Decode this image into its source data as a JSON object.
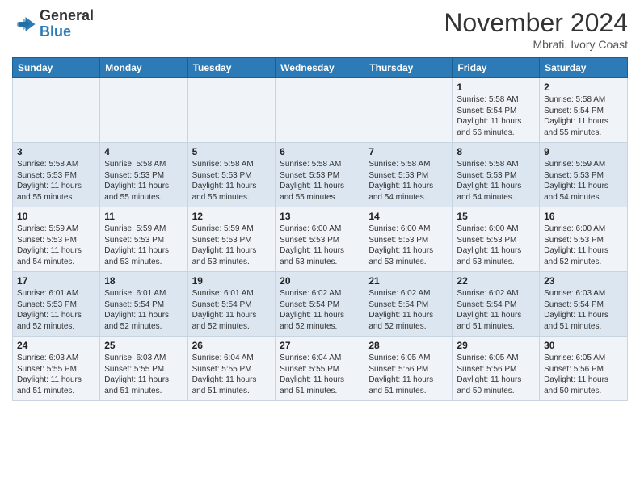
{
  "header": {
    "logo_general": "General",
    "logo_blue": "Blue",
    "month_title": "November 2024",
    "location": "Mbrati, Ivory Coast"
  },
  "weekdays": [
    "Sunday",
    "Monday",
    "Tuesday",
    "Wednesday",
    "Thursday",
    "Friday",
    "Saturday"
  ],
  "weeks": [
    [
      {
        "day": "",
        "sunrise": "",
        "sunset": "",
        "daylight": ""
      },
      {
        "day": "",
        "sunrise": "",
        "sunset": "",
        "daylight": ""
      },
      {
        "day": "",
        "sunrise": "",
        "sunset": "",
        "daylight": ""
      },
      {
        "day": "",
        "sunrise": "",
        "sunset": "",
        "daylight": ""
      },
      {
        "day": "",
        "sunrise": "",
        "sunset": "",
        "daylight": ""
      },
      {
        "day": "1",
        "sunrise": "Sunrise: 5:58 AM",
        "sunset": "Sunset: 5:54 PM",
        "daylight": "Daylight: 11 hours and 56 minutes."
      },
      {
        "day": "2",
        "sunrise": "Sunrise: 5:58 AM",
        "sunset": "Sunset: 5:54 PM",
        "daylight": "Daylight: 11 hours and 55 minutes."
      }
    ],
    [
      {
        "day": "3",
        "sunrise": "Sunrise: 5:58 AM",
        "sunset": "Sunset: 5:53 PM",
        "daylight": "Daylight: 11 hours and 55 minutes."
      },
      {
        "day": "4",
        "sunrise": "Sunrise: 5:58 AM",
        "sunset": "Sunset: 5:53 PM",
        "daylight": "Daylight: 11 hours and 55 minutes."
      },
      {
        "day": "5",
        "sunrise": "Sunrise: 5:58 AM",
        "sunset": "Sunset: 5:53 PM",
        "daylight": "Daylight: 11 hours and 55 minutes."
      },
      {
        "day": "6",
        "sunrise": "Sunrise: 5:58 AM",
        "sunset": "Sunset: 5:53 PM",
        "daylight": "Daylight: 11 hours and 55 minutes."
      },
      {
        "day": "7",
        "sunrise": "Sunrise: 5:58 AM",
        "sunset": "Sunset: 5:53 PM",
        "daylight": "Daylight: 11 hours and 54 minutes."
      },
      {
        "day": "8",
        "sunrise": "Sunrise: 5:58 AM",
        "sunset": "Sunset: 5:53 PM",
        "daylight": "Daylight: 11 hours and 54 minutes."
      },
      {
        "day": "9",
        "sunrise": "Sunrise: 5:59 AM",
        "sunset": "Sunset: 5:53 PM",
        "daylight": "Daylight: 11 hours and 54 minutes."
      }
    ],
    [
      {
        "day": "10",
        "sunrise": "Sunrise: 5:59 AM",
        "sunset": "Sunset: 5:53 PM",
        "daylight": "Daylight: 11 hours and 54 minutes."
      },
      {
        "day": "11",
        "sunrise": "Sunrise: 5:59 AM",
        "sunset": "Sunset: 5:53 PM",
        "daylight": "Daylight: 11 hours and 53 minutes."
      },
      {
        "day": "12",
        "sunrise": "Sunrise: 5:59 AM",
        "sunset": "Sunset: 5:53 PM",
        "daylight": "Daylight: 11 hours and 53 minutes."
      },
      {
        "day": "13",
        "sunrise": "Sunrise: 6:00 AM",
        "sunset": "Sunset: 5:53 PM",
        "daylight": "Daylight: 11 hours and 53 minutes."
      },
      {
        "day": "14",
        "sunrise": "Sunrise: 6:00 AM",
        "sunset": "Sunset: 5:53 PM",
        "daylight": "Daylight: 11 hours and 53 minutes."
      },
      {
        "day": "15",
        "sunrise": "Sunrise: 6:00 AM",
        "sunset": "Sunset: 5:53 PM",
        "daylight": "Daylight: 11 hours and 53 minutes."
      },
      {
        "day": "16",
        "sunrise": "Sunrise: 6:00 AM",
        "sunset": "Sunset: 5:53 PM",
        "daylight": "Daylight: 11 hours and 52 minutes."
      }
    ],
    [
      {
        "day": "17",
        "sunrise": "Sunrise: 6:01 AM",
        "sunset": "Sunset: 5:53 PM",
        "daylight": "Daylight: 11 hours and 52 minutes."
      },
      {
        "day": "18",
        "sunrise": "Sunrise: 6:01 AM",
        "sunset": "Sunset: 5:54 PM",
        "daylight": "Daylight: 11 hours and 52 minutes."
      },
      {
        "day": "19",
        "sunrise": "Sunrise: 6:01 AM",
        "sunset": "Sunset: 5:54 PM",
        "daylight": "Daylight: 11 hours and 52 minutes."
      },
      {
        "day": "20",
        "sunrise": "Sunrise: 6:02 AM",
        "sunset": "Sunset: 5:54 PM",
        "daylight": "Daylight: 11 hours and 52 minutes."
      },
      {
        "day": "21",
        "sunrise": "Sunrise: 6:02 AM",
        "sunset": "Sunset: 5:54 PM",
        "daylight": "Daylight: 11 hours and 52 minutes."
      },
      {
        "day": "22",
        "sunrise": "Sunrise: 6:02 AM",
        "sunset": "Sunset: 5:54 PM",
        "daylight": "Daylight: 11 hours and 51 minutes."
      },
      {
        "day": "23",
        "sunrise": "Sunrise: 6:03 AM",
        "sunset": "Sunset: 5:54 PM",
        "daylight": "Daylight: 11 hours and 51 minutes."
      }
    ],
    [
      {
        "day": "24",
        "sunrise": "Sunrise: 6:03 AM",
        "sunset": "Sunset: 5:55 PM",
        "daylight": "Daylight: 11 hours and 51 minutes."
      },
      {
        "day": "25",
        "sunrise": "Sunrise: 6:03 AM",
        "sunset": "Sunset: 5:55 PM",
        "daylight": "Daylight: 11 hours and 51 minutes."
      },
      {
        "day": "26",
        "sunrise": "Sunrise: 6:04 AM",
        "sunset": "Sunset: 5:55 PM",
        "daylight": "Daylight: 11 hours and 51 minutes."
      },
      {
        "day": "27",
        "sunrise": "Sunrise: 6:04 AM",
        "sunset": "Sunset: 5:55 PM",
        "daylight": "Daylight: 11 hours and 51 minutes."
      },
      {
        "day": "28",
        "sunrise": "Sunrise: 6:05 AM",
        "sunset": "Sunset: 5:56 PM",
        "daylight": "Daylight: 11 hours and 51 minutes."
      },
      {
        "day": "29",
        "sunrise": "Sunrise: 6:05 AM",
        "sunset": "Sunset: 5:56 PM",
        "daylight": "Daylight: 11 hours and 50 minutes."
      },
      {
        "day": "30",
        "sunrise": "Sunrise: 6:05 AM",
        "sunset": "Sunset: 5:56 PM",
        "daylight": "Daylight: 11 hours and 50 minutes."
      }
    ]
  ]
}
